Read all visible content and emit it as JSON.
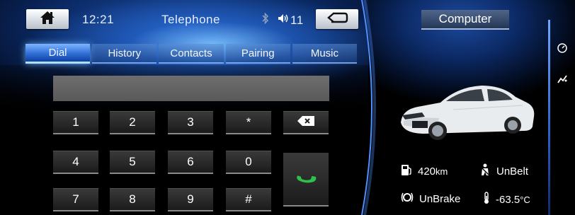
{
  "status_bar": {
    "time": "12:21",
    "title": "Telephone",
    "volume": "11"
  },
  "tabs": [
    {
      "label": "Dial",
      "active": true
    },
    {
      "label": "History",
      "active": false
    },
    {
      "label": "Contacts",
      "active": false
    },
    {
      "label": "Pairing",
      "active": false
    },
    {
      "label": "Music",
      "active": false
    }
  ],
  "keypad": {
    "keys": [
      "1",
      "2",
      "3",
      "*",
      "4",
      "5",
      "6",
      "0",
      "7",
      "8",
      "9",
      "#"
    ],
    "delete_icon": "backspace-icon",
    "call_icon": "phone-icon"
  },
  "computer": {
    "title": "Computer",
    "range": "420",
    "range_unit": "km",
    "belt_status": "UnBelt",
    "brake_status": "UnBrake",
    "temperature": "-63.5",
    "temperature_unit": "°C"
  },
  "icons": {
    "home": "home-icon",
    "back": "back-arrow-icon",
    "bluetooth": "bluetooth-icon",
    "volume": "speaker-icon",
    "fuel": "fuel-pump-icon",
    "seatbelt": "seatbelt-icon",
    "brake": "brake-icon",
    "thermometer": "thermometer-icon",
    "side_speed": "speedometer-icon",
    "side_wave": "trip-icon"
  },
  "colors": {
    "accent": "#2f6fd6",
    "call_green": "#2fc24a"
  }
}
